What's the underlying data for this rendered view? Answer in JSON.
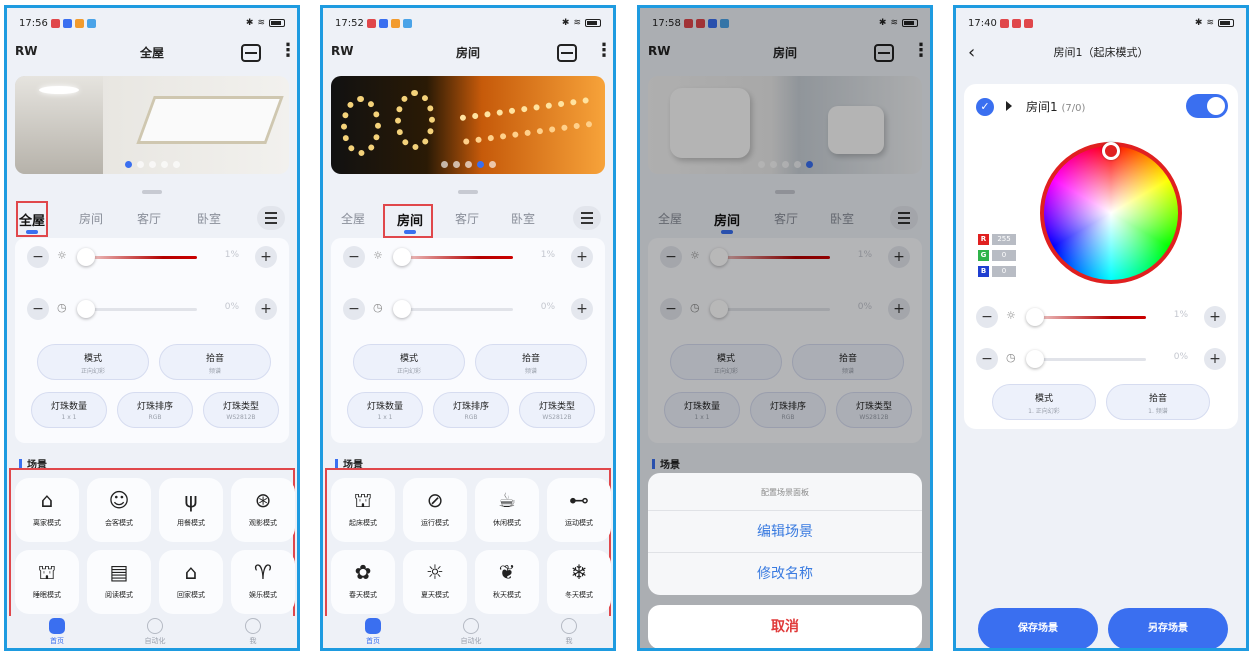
{
  "colors": {
    "accent": "#3a6ff0",
    "highlight": "#e0474b",
    "slider_red": "#b30000",
    "cancel": "#e03a3a"
  },
  "p1": {
    "time": "17:56",
    "brand": "RW",
    "title": "全屋",
    "tabs": [
      "全屋",
      "房间",
      "客厅",
      "卧室"
    ],
    "brightness_pct": "1%",
    "speed_pct": "0%",
    "mode": {
      "label": "模式",
      "value": "正向幻彩"
    },
    "pickup": {
      "label": "拾音",
      "value": "频谱"
    },
    "bead_count": {
      "label": "灯珠数量",
      "value": "1 x 1"
    },
    "bead_order": {
      "label": "灯珠排序",
      "value": "RGB"
    },
    "bead_type": {
      "label": "灯珠类型",
      "value": "WS2812B"
    },
    "section": "场景",
    "scenes": [
      "离家模式",
      "会客模式",
      "用餐模式",
      "观影模式",
      "睡眠模式",
      "阅读模式",
      "回家模式",
      "娱乐模式"
    ],
    "nav": [
      "首页",
      "自动化",
      "我"
    ]
  },
  "p2": {
    "time": "17:52",
    "brand": "RW",
    "title": "房间",
    "tabs": [
      "全屋",
      "房间",
      "客厅",
      "卧室"
    ],
    "brightness_pct": "1%",
    "speed_pct": "0%",
    "mode": {
      "label": "模式",
      "value": "正向幻彩"
    },
    "pickup": {
      "label": "拾音",
      "value": "频谱"
    },
    "bead_count": {
      "label": "灯珠数量",
      "value": "1 x 1"
    },
    "bead_order": {
      "label": "灯珠排序",
      "value": "RGB"
    },
    "bead_type": {
      "label": "灯珠类型",
      "value": "WS2812B"
    },
    "section": "场景",
    "scenes": [
      "起床模式",
      "运行模式",
      "休闲模式",
      "运动模式",
      "春天模式",
      "夏天模式",
      "秋天模式",
      "冬天模式"
    ],
    "nav": [
      "首页",
      "自动化",
      "我"
    ]
  },
  "p3": {
    "time": "17:58",
    "brand": "RW",
    "title": "房间",
    "tabs": [
      "全屋",
      "房间",
      "客厅",
      "卧室"
    ],
    "brightness_pct": "1%",
    "speed_pct": "0%",
    "mode": {
      "label": "模式",
      "value": "正向幻彩"
    },
    "pickup": {
      "label": "拾音",
      "value": "频谱"
    },
    "bead_count": {
      "label": "灯珠数量",
      "value": "1 x 1"
    },
    "bead_order": {
      "label": "灯珠排序",
      "value": "RGB"
    },
    "bead_type": {
      "label": "灯珠类型",
      "value": "WS2812B"
    },
    "section": "场景",
    "sheet_title": "配置场景面板",
    "edit_scene": "编辑场景",
    "rename": "修改名称",
    "cancel": "取消"
  },
  "p4": {
    "time": "17:40",
    "title": "房间1（起床模式）",
    "room_name": "房间1",
    "room_count": "(7/0)",
    "rgb": {
      "r": "255",
      "g": "0",
      "b": "0"
    },
    "brightness_pct": "1%",
    "speed_pct": "0%",
    "mode": {
      "label": "模式",
      "value": "1. 正向幻彩"
    },
    "pickup": {
      "label": "拾音",
      "value": "1. 频谱"
    },
    "save": "保存场景",
    "save_as": "另存场景"
  }
}
